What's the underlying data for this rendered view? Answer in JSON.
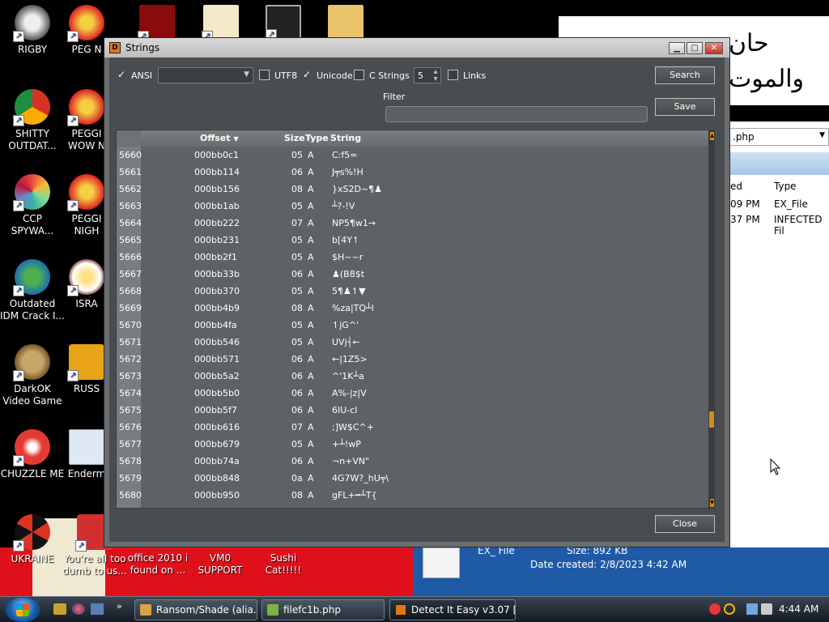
{
  "desktop": {
    "icons": [
      {
        "label": "RIGBY"
      },
      {
        "label": "PEG N"
      },
      {
        "label": "SHITTY OUTDAT..."
      },
      {
        "label": "PEGGI WOW N"
      },
      {
        "label": "CCP SPYWA..."
      },
      {
        "label": "PEGGI NIGH"
      },
      {
        "label": "Outdated IDM Crack I..."
      },
      {
        "label": "ISRA"
      },
      {
        "label": "DarkOK Video Game"
      },
      {
        "label": "RUSS"
      },
      {
        "label": "CHUZZLE ME"
      },
      {
        "label": "Enderm"
      },
      {
        "label": "UKRAINE"
      },
      {
        "label": "You're all too dumb to us..."
      },
      {
        "label": "office 2010 i found on ..."
      },
      {
        "label": "VM0 SUPPORT"
      },
      {
        "label": "Sushi Cat!!!!!"
      }
    ],
    "arabic_line1": "حان",
    "arabic_line2": "والموت",
    "explorer": {
      "address": ".php",
      "col_date_partial": "ed",
      "col_type": "Type",
      "row1_time": "09 PM",
      "row1_type": "EX_File",
      "row2_time": "37 PM",
      "row2_type": "INFECTED Fil",
      "details_name": "EX_ File",
      "details_size": "Size: 892 KB",
      "details_date": "Date created: 2/8/2023 4:42 AM"
    }
  },
  "dialog": {
    "title": "Strings",
    "icon_glyph": "D",
    "window_buttons": {
      "min": "▁",
      "max": "□",
      "close": "✕"
    },
    "options": {
      "ansi_label": "ANSI",
      "ansi_checked": true,
      "ansi_value": "",
      "utf8_label": "UTF8",
      "utf8_checked": false,
      "unicode_label": "Unicode",
      "unicode_checked": true,
      "cstrings_label": "C Strings",
      "cstrings_checked": false,
      "cstrings_min": "5",
      "links_label": "Links",
      "links_checked": false
    },
    "filter_label": "Filter",
    "filter_value": "",
    "search_label": "Search",
    "save_label": "Save",
    "close_label": "Close",
    "columns": {
      "offset": "Offset",
      "size": "Size",
      "type": "Type",
      "string": "String"
    },
    "rows": [
      {
        "idx": "5660",
        "offset": "000bb0c1",
        "size": "05",
        "type": "A",
        "string": "C:f5="
      },
      {
        "idx": "5661",
        "offset": "000bb114",
        "size": "06",
        "type": "A",
        "string": "J╤s%!H"
      },
      {
        "idx": "5662",
        "offset": "000bb156",
        "size": "08",
        "type": "A",
        "string": "}xS2D~¶♟"
      },
      {
        "idx": "5663",
        "offset": "000bb1ab",
        "size": "05",
        "type": "A",
        "string": "┴?-!V"
      },
      {
        "idx": "5664",
        "offset": "000bb222",
        "size": "07",
        "type": "A",
        "string": "NP5¶w1→"
      },
      {
        "idx": "5665",
        "offset": "000bb231",
        "size": "05",
        "type": "A",
        "string": "b[4Y↿"
      },
      {
        "idx": "5666",
        "offset": "000bb2f1",
        "size": "05",
        "type": "A",
        "string": "$H~~r"
      },
      {
        "idx": "5667",
        "offset": "000bb33b",
        "size": "06",
        "type": "A",
        "string": "♟(B8$t"
      },
      {
        "idx": "5668",
        "offset": "000bb370",
        "size": "05",
        "type": "A",
        "string": "5¶♟↿▼"
      },
      {
        "idx": "5669",
        "offset": "000bb4b9",
        "size": "08",
        "type": "A",
        "string": "%za|TQ┴l"
      },
      {
        "idx": "5670",
        "offset": "000bb4fa",
        "size": "05",
        "type": "A",
        "string": "↿jG^'"
      },
      {
        "idx": "5671",
        "offset": "000bb546",
        "size": "05",
        "type": "A",
        "string": "UVj┤←"
      },
      {
        "idx": "5672",
        "offset": "000bb571",
        "size": "06",
        "type": "A",
        "string": "←|1Z5>"
      },
      {
        "idx": "5673",
        "offset": "000bb5a2",
        "size": "06",
        "type": "A",
        "string": "^'1K┴a"
      },
      {
        "idx": "5674",
        "offset": "000bb5b0",
        "size": "06",
        "type": "A",
        "string": "A%-|z|V"
      },
      {
        "idx": "5675",
        "offset": "000bb5f7",
        "size": "06",
        "type": "A",
        "string": "6IU-cI"
      },
      {
        "idx": "5676",
        "offset": "000bb616",
        "size": "07",
        "type": "A",
        "string": ";]W$C^+"
      },
      {
        "idx": "5677",
        "offset": "000bb679",
        "size": "05",
        "type": "A",
        "string": "+┴!wP"
      },
      {
        "idx": "5678",
        "offset": "000bb74a",
        "size": "06",
        "type": "A",
        "string": "¬n+VN\""
      },
      {
        "idx": "5679",
        "offset": "000bb848",
        "size": "0a",
        "type": "A",
        "string": "4G7W?_hU╤\\"
      },
      {
        "idx": "5680",
        "offset": "000bb950",
        "size": "08",
        "type": "A",
        "string": "gFL+╍┴T{"
      }
    ],
    "scroll_position": 0.79
  },
  "taskbar": {
    "tasks": [
      {
        "label": "Ransom/Shade (alia..."
      },
      {
        "label": "filefc1b.php"
      },
      {
        "label": "Detect It Easy v3.07 [..."
      }
    ],
    "clock": "4:44 AM"
  }
}
